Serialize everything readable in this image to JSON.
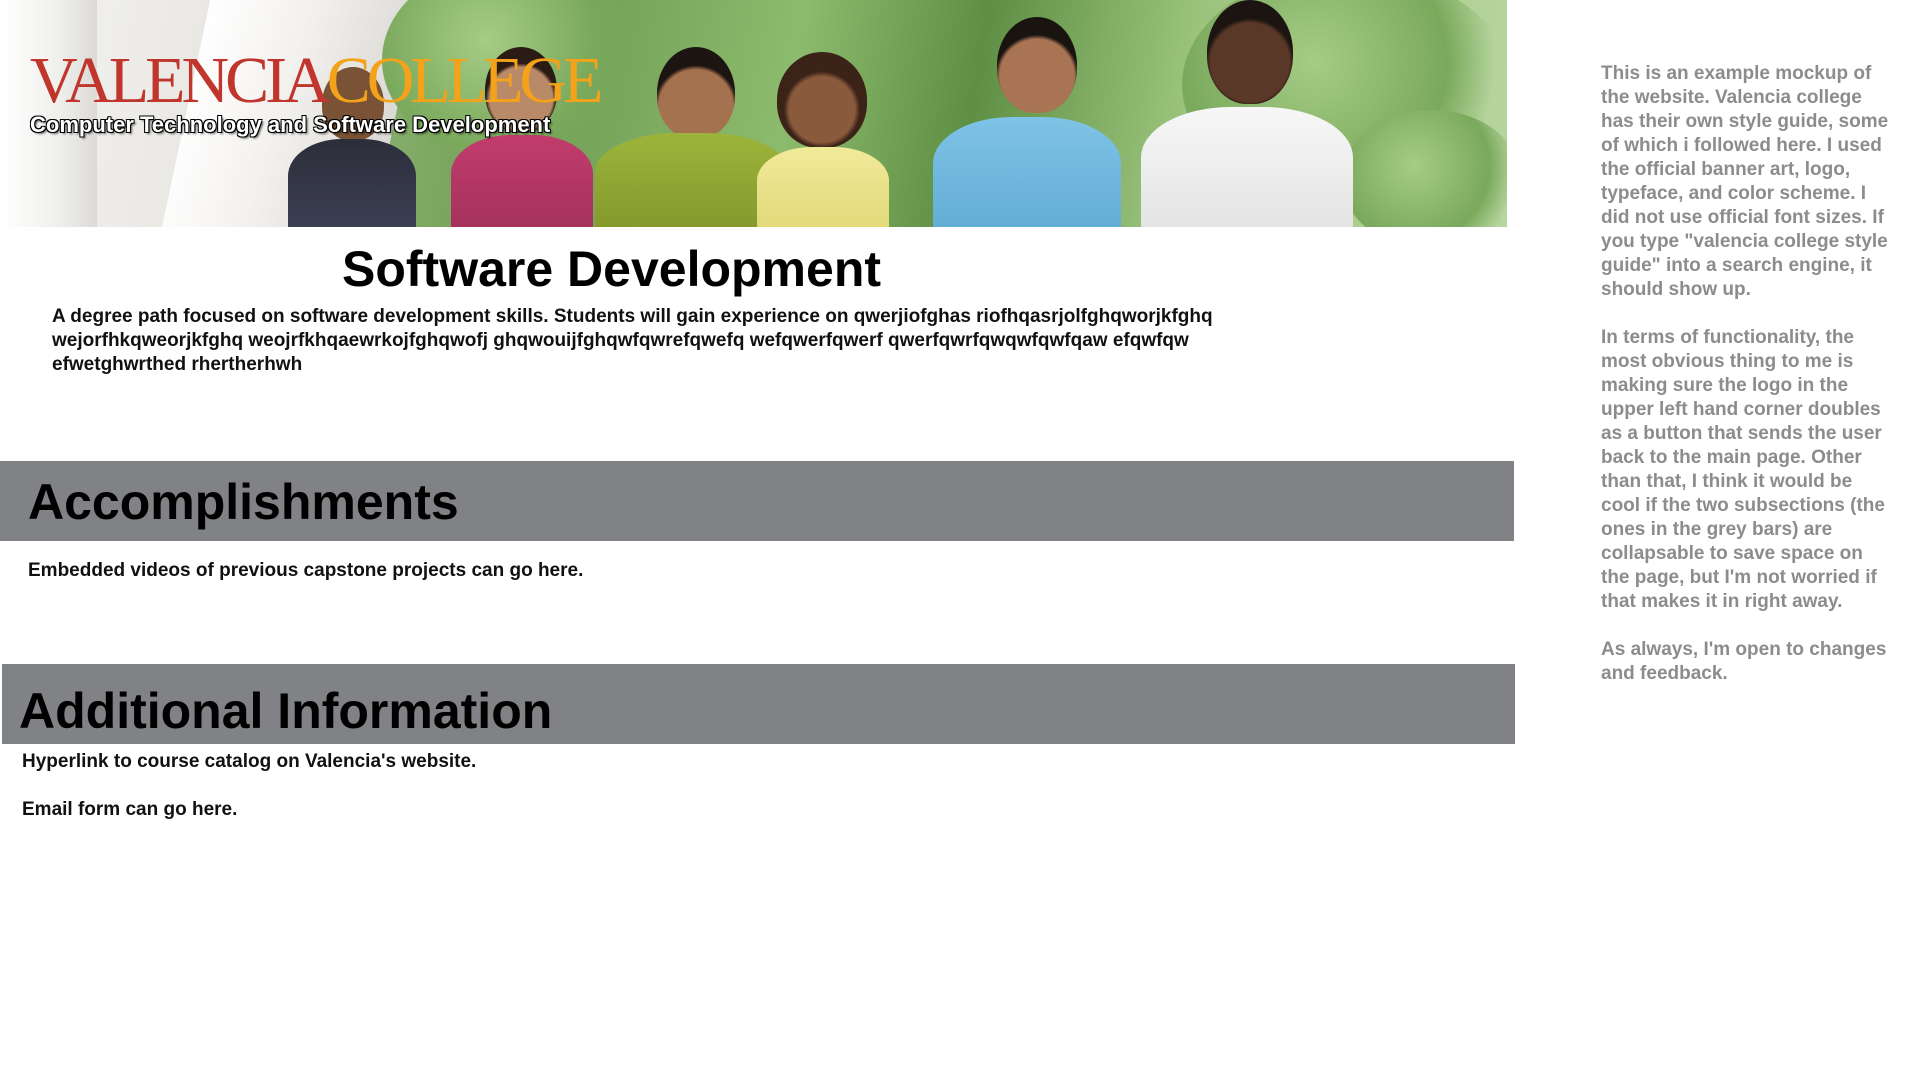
{
  "banner": {
    "logo_part1": "VALENCIA",
    "logo_part2": "COLLEGE",
    "subtitle": "Computer Technology and Software Development"
  },
  "main": {
    "title": "Software Development",
    "intro": "A degree path focused on software development skills. Students will gain experience on qwerjiofghas riofhqasrjolfghqworjkfghq wejorfhkqweorjkfghq weojrfkhqaewrkojfghqwofj ghqwouijfghqwfqwrefqwefq wefqwerfqwerf qwerfqwrfqwqwfqwfqaw efqwfqw efwetghwrthed rhertherhwh"
  },
  "sections": {
    "accomplishments": {
      "title": "Accomplishments",
      "text": "Embedded videos of previous capstone projects can go here."
    },
    "additional": {
      "title": "Additional Information",
      "link_text": "Hyperlink to course catalog on Valencia's website.",
      "email_text": "Email form can go here."
    }
  },
  "side_note": {
    "paragraph1": "This is an example mockup of the website. Valencia college has their own style guide, some of which i followed here. I used the official banner art, logo, typeface, and color scheme. I did not use official font sizes. If you type \"valencia college style guide\" into a search engine, it should show up.",
    "paragraph2": "In terms of functionality, the most obvious thing to me is making sure the logo in the upper left hand corner doubles as a button that sends the user back to the main page. Other than that, I think it would be cool if the two subsections (the ones in the grey bars) are collapsable to save space on the page, but I'm not worried if that makes it in right away.",
    "paragraph3": "As always, I'm open to changes and feedback."
  },
  "colors": {
    "logo_red": "#c0362c",
    "logo_gold": "#f3a21a",
    "section_bar": "#818285",
    "side_note_text": "#8c8c8c"
  }
}
